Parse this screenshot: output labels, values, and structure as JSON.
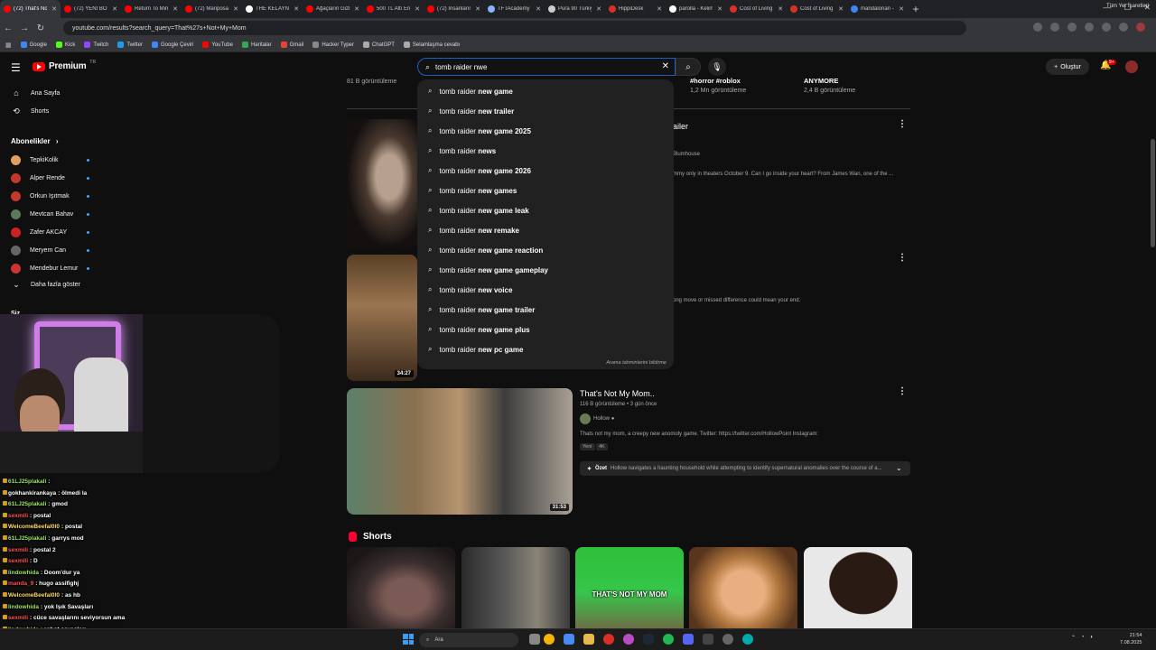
{
  "browser": {
    "tabs": [
      {
        "label": "(72) That's No",
        "color": "#ff0000",
        "active": true
      },
      {
        "label": "(72) YENİ BÖLÜ",
        "color": "#ff0000"
      },
      {
        "label": "Return To Mine",
        "color": "#ff0000"
      },
      {
        "label": "(72) Mariposa",
        "color": "#ff0000"
      },
      {
        "label": "THE KELAYNAK",
        "color": "#ffffff"
      },
      {
        "label": "Ağaçların Gizli",
        "color": "#ff0000"
      },
      {
        "label": "500 TL Altı En",
        "color": "#ff0000"
      },
      {
        "label": "(72) İnsanların",
        "color": "#ff0000"
      },
      {
        "label": "TFTAcademy",
        "color": "#8ab4f8"
      },
      {
        "label": "Pura 90 Türkiye",
        "color": "#cccccc"
      },
      {
        "label": "HippiDesk",
        "color": "#d93025"
      },
      {
        "label": "parolla - Kelim",
        "color": "#ffffff"
      },
      {
        "label": "Cost of Living",
        "color": "#d93025"
      },
      {
        "label": "Cost of Living",
        "color": "#d93025"
      },
      {
        "label": "mandalorian -",
        "color": "#4285f4"
      }
    ],
    "url": "youtube.com/results?search_query=That%27s+Not+My+Mom",
    "bookmarks": [
      {
        "label": "Google",
        "color": "#4285f4"
      },
      {
        "label": "Kick",
        "color": "#53fc18"
      },
      {
        "label": "Twitch",
        "color": "#9146ff"
      },
      {
        "label": "Twitter",
        "color": "#1d9bf0"
      },
      {
        "label": "Google Çeviri",
        "color": "#4285f4"
      },
      {
        "label": "YouTube",
        "color": "#ff0000"
      },
      {
        "label": "Haritalar",
        "color": "#34a853"
      },
      {
        "label": "Gmail",
        "color": "#ea4335"
      },
      {
        "label": "Hacker Typer",
        "color": "#888888"
      },
      {
        "label": "ChatGPT",
        "color": "#aaaaaa"
      },
      {
        "label": "Selamlaşma cevabı",
        "color": "#aaaaaa"
      }
    ],
    "bookmarks_right": "Tüm Yer İşaretleri"
  },
  "header": {
    "logo_text": "Premium",
    "logo_tr": "TR",
    "search_value": "tomb raider nwe",
    "create_label": "Oluştur",
    "notif_count": "9+"
  },
  "sidebar": {
    "home": "Ana Sayfa",
    "shorts": "Shorts",
    "subs_heading": "Abonelikler",
    "channels": [
      {
        "name": "TepkiKolik",
        "color": "#e0a060"
      },
      {
        "name": "Alper Rende",
        "color": "#c0392b"
      },
      {
        "name": "Orkun Işıtmak",
        "color": "#c0392b"
      },
      {
        "name": "Mevtcan Bahav",
        "color": "#5a7a5a"
      },
      {
        "name": "Zafer AKCAY",
        "color": "#cc2222"
      },
      {
        "name": "Meryem Can",
        "color": "#666666"
      },
      {
        "name": "Mendebur Lemur",
        "color": "#cc3333"
      }
    ],
    "show_more": "Daha fazla göster",
    "you_heading": "Siz"
  },
  "chat": [
    {
      "name": "61LJ25plakali",
      "text": ":",
      "color": "#9be26b"
    },
    {
      "name": "gokhankirankaya",
      "text": ": ölmedi la",
      "color": "#ffffff"
    },
    {
      "name": "61LJ25plakali",
      "text": ": gmod",
      "color": "#9be26b"
    },
    {
      "name": "sexmili",
      "text": ": postal",
      "color": "#ff4f4f"
    },
    {
      "name": "WelcomeBeefal0l0",
      "text": ": postal",
      "color": "#ffd86b"
    },
    {
      "name": "61LJ25plakali",
      "text": ": garrys mod",
      "color": "#9be26b"
    },
    {
      "name": "sexmili",
      "text": ": postal 2",
      "color": "#ff4f4f"
    },
    {
      "name": "sexmili",
      "text": ": D",
      "color": "#ff4f4f"
    },
    {
      "name": "lindowhida",
      "text": ": Doom'dur ya",
      "color": "#9be26b"
    },
    {
      "name": "manda_9",
      "text": ": hugo assifighj",
      "color": "#ff4f4f"
    },
    {
      "name": "WelcomeBeefal0l0",
      "text": ": as hb",
      "color": "#ffd86b"
    },
    {
      "name": "lindowhida",
      "text": ": yok Işık Savaşları",
      "color": "#9be26b"
    },
    {
      "name": "sexmili",
      "text": ": cüce savaşlarını seviyorsun ama",
      "color": "#ff4f4f"
    },
    {
      "name": "lindowhida",
      "text": ": robot savaşları",
      "color": "#9be26b"
    },
    {
      "name": "sexmili",
      "text": ": mığfer dibi linebahtı savaşı",
      "color": "#ff4f4f"
    }
  ],
  "results": {
    "top_views": "81 B görüntüleme",
    "stat_a_title": "#horror #roblox",
    "stat_a_views": "1,2 Mn görüntüleme",
    "stat_b_title": "ANYMORE",
    "stat_b_views": "2,4 B görüntüleme",
    "r1_title_tail": "ailer",
    "r1_channel": "Blumhouse",
    "r1_desc": "mmy only in theaters October 9. Can I go inside your heart? From James Wan, one of the ...",
    "r2_desc": "ong move or missed difference could mean your end.",
    "r2_duration": "34:27",
    "v3": {
      "title": "That's Not My Mom..",
      "meta": "116 B görüntüleme • 3 gün önce",
      "channel": "Hollow",
      "desc": "Thats not my mom, a creepy new anomoly game. Twitter: https://twitter.com/HollowPoint Instagram:",
      "tags": [
        "Yeni",
        "4K"
      ],
      "summary_label": "Özet",
      "summary": "Hollow navigates a haunting household while attempting to identify supernatural anomalies over the course of a...",
      "duration": "31:53"
    },
    "shorts_heading": "Shorts",
    "short3_caption": "THAT'S NOT MY MOM"
  },
  "suggestions": {
    "typed": "tomb raider",
    "items": [
      "new game",
      "new trailer",
      "new game 2025",
      "news",
      "new game 2026",
      "new games",
      "new game leak",
      "new remake",
      "new game reaction",
      "new game gameplay",
      "new voice",
      "new game trailer",
      "new game plus",
      "new pc game"
    ],
    "report": "Arama tahminlerini bildirme"
  },
  "taskbar": {
    "search_label": "Ara",
    "time": "21:54",
    "date": "7.08.2025"
  },
  "colors": {
    "accent": "#1c62b9",
    "brand_red": "#ff0000",
    "background": "#0f0f0f"
  }
}
